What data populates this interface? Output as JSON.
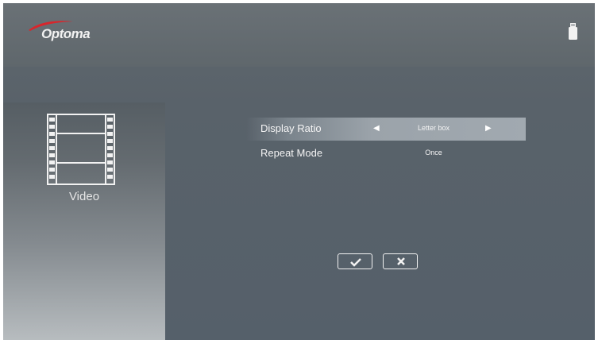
{
  "brand": {
    "logo_text": "Optoma",
    "swoosh_color": "#d8262c"
  },
  "status": {
    "storage_icon": "usb-drive-icon"
  },
  "media": {
    "icon": "film-strip-icon",
    "label": "Video"
  },
  "settings": {
    "rows": [
      {
        "label": "Display Ratio",
        "value": "Letter box",
        "selected": true,
        "left_arrow": "◀",
        "right_arrow": "▶"
      },
      {
        "label": "Repeat Mode",
        "value": "Once",
        "selected": false
      }
    ]
  },
  "buttons": {
    "confirm_icon": "checkmark-icon",
    "cancel_icon": "close-icon"
  }
}
